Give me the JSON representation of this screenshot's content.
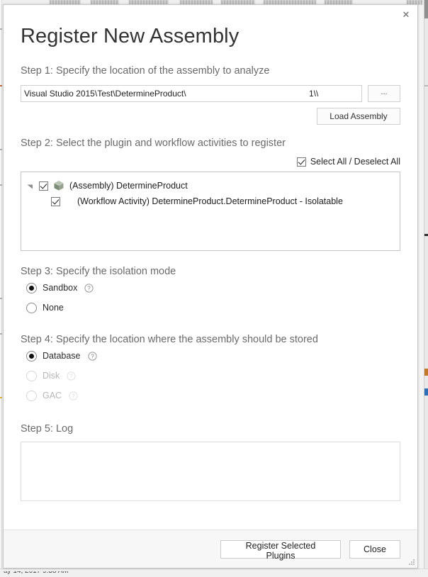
{
  "window": {
    "close_icon": "close-icon",
    "resize_grip": "resize-grip"
  },
  "background": {
    "status_timestamp": "ay 14, 2017 9:38 AM"
  },
  "dialog": {
    "title": "Register New Assembly"
  },
  "step1": {
    "label": "Step 1: Specify the location of the assembly to analyze",
    "path_value": "\\\\1                                                    \\Visual Studio 2015\\Test\\DetermineProduct",
    "path_placeholder": "",
    "browse_label": "...",
    "load_assembly_label": "Load Assembly"
  },
  "step2": {
    "label": "Step 2: Select the plugin and workflow activities to register",
    "select_all_label": "Select All / Deselect All",
    "select_all_checked": true,
    "tree": [
      {
        "label": "(Assembly) DetermineProduct",
        "checked": true,
        "icon": "assembly-package-icon",
        "expanded": true,
        "children": [
          {
            "label": "(Workflow Activity) DetermineProduct.DetermineProduct - Isolatable",
            "checked": true
          }
        ]
      }
    ]
  },
  "step3": {
    "label": "Step 3: Specify the isolation mode",
    "options": [
      {
        "label": "Sandbox",
        "selected": true,
        "disabled": false,
        "help": true
      },
      {
        "label": "None",
        "selected": false,
        "disabled": false,
        "help": false
      }
    ]
  },
  "step4": {
    "label": "Step 4: Specify the location where the assembly should be stored",
    "options": [
      {
        "label": "Database",
        "selected": true,
        "disabled": false,
        "help": true
      },
      {
        "label": "Disk",
        "selected": false,
        "disabled": true,
        "help": true
      },
      {
        "label": "GAC",
        "selected": false,
        "disabled": true,
        "help": true
      }
    ]
  },
  "step5": {
    "label": "Step 5: Log",
    "log_text": ""
  },
  "footer": {
    "register_label": "Register Selected Plugins",
    "close_label": "Close"
  },
  "colors": {
    "dialog_bg": "#ffffff",
    "title_text": "#333333",
    "step_label_text": "#6a6a6a",
    "border": "#c8c8c8",
    "footer_bg": "#f7f7f7",
    "disabled_text": "#b6b6b6",
    "assembly_icon": "#8f9e8b"
  }
}
